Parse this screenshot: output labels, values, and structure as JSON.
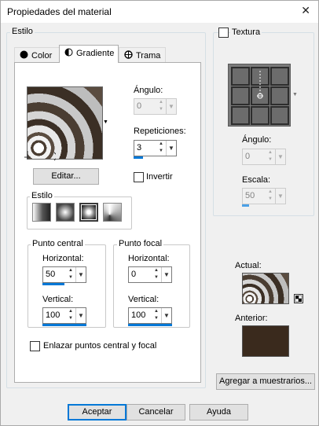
{
  "window": {
    "title": "Propiedades del material",
    "close_glyph": "✕"
  },
  "estilo": {
    "label": "Estilo",
    "tabs": [
      {
        "label": "Color",
        "icon": "filled-circle-icon"
      },
      {
        "label": "Gradiente",
        "icon": "half-circle-icon"
      },
      {
        "label": "Trama",
        "icon": "globe-icon"
      }
    ],
    "active_tab": "Gradiente"
  },
  "gradient": {
    "angle_label": "Ángulo:",
    "angle_value": "0",
    "repeats_label": "Repeticiones:",
    "repeats_value": "3",
    "edit_button": "Editar...",
    "invert_label": "Invertir",
    "style_group_label": "Estilo",
    "style_types": [
      "linear",
      "rectangular",
      "radial",
      "sunburst"
    ],
    "selected_style": "radial",
    "center_label": "Punto central",
    "focal_label": "Punto focal",
    "center_h_label": "Horizontal:",
    "center_h_value": "50",
    "center_v_label": "Vertical:",
    "center_v_value": "100",
    "focal_h_label": "Horizontal:",
    "focal_h_value": "0",
    "focal_v_label": "Vertical:",
    "focal_v_value": "100",
    "link_label": "Enlazar puntos central y focal"
  },
  "texture": {
    "label": "Textura",
    "angle_label": "Ángulo:",
    "angle_value": "0",
    "scale_label": "Escala:",
    "scale_value": "50"
  },
  "preview": {
    "current_label": "Actual:",
    "previous_label": "Anterior:",
    "previous_color": "#3a2a1d"
  },
  "buttons": {
    "add_swatches": "Agregar a muestrarios...",
    "ok": "Aceptar",
    "cancel": "Cancelar",
    "help": "Ayuda"
  }
}
